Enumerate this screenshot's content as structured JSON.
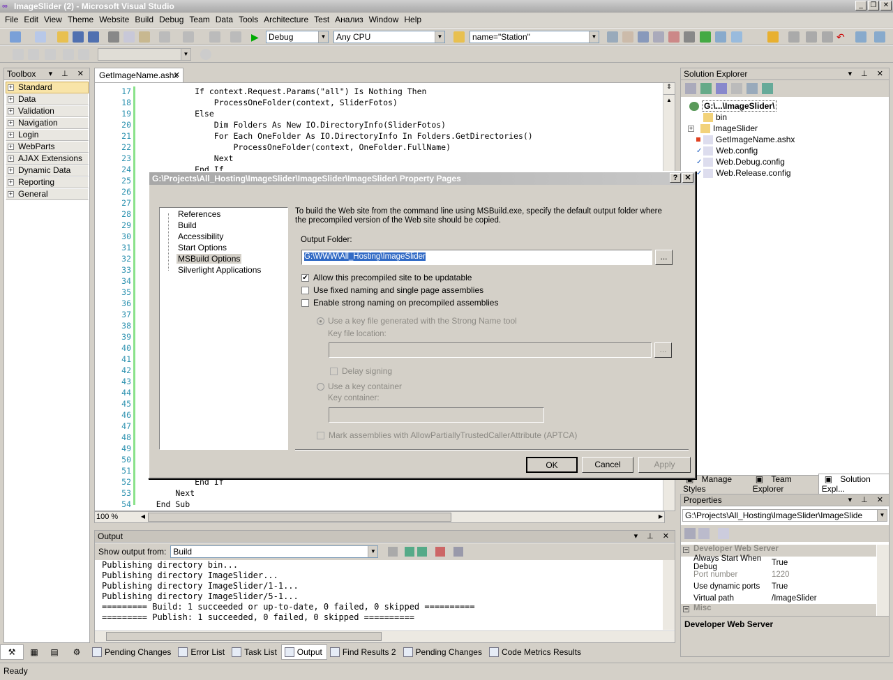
{
  "window": {
    "title": "ImageSlider (2) - Microsoft Visual Studio"
  },
  "menu": [
    "File",
    "Edit",
    "View",
    "Theme",
    "Website",
    "Build",
    "Debug",
    "Team",
    "Data",
    "Tools",
    "Architecture",
    "Test",
    "Анализ",
    "Window",
    "Help"
  ],
  "toolbar": {
    "config": "Debug",
    "platform": "Any CPU",
    "find": "name=\"Station\""
  },
  "toolbox": {
    "title": "Toolbox",
    "items": [
      "Standard",
      "Data",
      "Validation",
      "Navigation",
      "Login",
      "WebParts",
      "AJAX Extensions",
      "Dynamic Data",
      "Reporting",
      "General"
    ]
  },
  "editor": {
    "tab": "GetImageName.ashx",
    "lines": [
      {
        "n": "17",
        "code": "            If context.Request.Params(\"all\") Is Nothing Then"
      },
      {
        "n": "18",
        "code": "                ProcessOneFolder(context, SliderFotos)"
      },
      {
        "n": "19",
        "code": "            Else"
      },
      {
        "n": "20",
        "code": "                Dim Folders As New IO.DirectoryInfo(SliderFotos)"
      },
      {
        "n": "21",
        "code": "                For Each OneFolder As IO.DirectoryInfo In Folders.GetDirectories()"
      },
      {
        "n": "22",
        "code": "                    ProcessOneFolder(context, OneFolder.FullName)"
      },
      {
        "n": "23",
        "code": "                Next"
      },
      {
        "n": "24",
        "code": "            End If"
      },
      {
        "n": "52",
        "code": "            End If"
      },
      {
        "n": "53",
        "code": "        Next"
      },
      {
        "n": "54",
        "code": "    End Sub"
      }
    ],
    "zoom": "100 %"
  },
  "output": {
    "title": "Output",
    "show_label": "Show output from:",
    "source": "Build",
    "lines": [
      "Publishing directory bin...",
      "Publishing directory ImageSlider...",
      "Publishing directory ImageSlider/1-1...",
      "Publishing directory ImageSlider/5-1...",
      "========= Build: 1 succeeded or up-to-date, 0 failed, 0 skipped ==========",
      "========= Publish: 1 succeeded, 0 failed, 0 skipped =========="
    ]
  },
  "bottom_tabs": [
    "Pending Changes",
    "Error List",
    "Task List",
    "Output",
    "Find Results 2",
    "Pending Changes",
    "Code Metrics Results"
  ],
  "status": "Ready",
  "solution_explorer": {
    "title": "Solution Explorer",
    "root": "G:\\...\\ImageSlider\\",
    "items": [
      "bin",
      "ImageSlider",
      "GetImageName.ashx",
      "Web.config",
      "Web.Debug.config",
      "Web.Release.config"
    ],
    "tabs": [
      "Manage Styles",
      "Team Explorer",
      "Solution Expl..."
    ]
  },
  "properties": {
    "title": "Properties",
    "object": "G:\\Projects\\All_Hosting\\ImageSlider\\ImageSlide",
    "category": "Developer Web Server",
    "rows": [
      {
        "k": "Always Start When Debug",
        "v": "True"
      },
      {
        "k": "Port number",
        "v": "1220"
      },
      {
        "k": "Use dynamic ports",
        "v": "True"
      },
      {
        "k": "Virtual path",
        "v": "/ImageSlider"
      }
    ],
    "category2": "Misc",
    "desc": "Developer Web Server"
  },
  "dialog": {
    "title": "G:\\Projects\\All_Hosting\\ImageSlider\\ImageSlider\\ImageSlider\\ Property Pages",
    "nav": [
      "References",
      "Build",
      "Accessibility",
      "Start Options",
      "MSBuild Options",
      "Silverlight Applications"
    ],
    "description": "To build the Web site from the command line using MSBuild.exe, specify the default output folder where the precompiled version of the Web site should be copied.",
    "output_folder_label": "Output Folder:",
    "output_folder": "G:\\WWW\\All_Hosting\\ImageSlider",
    "browse": "...",
    "chk_updatable": "Allow this precompiled site to be updatable",
    "chk_fixed": "Use fixed naming and single page assemblies",
    "chk_strong": "Enable strong naming on precompiled assemblies",
    "radio_keyfile": "Use a key file generated with the Strong Name tool",
    "key_file_label": "Key file location:",
    "delay_signing": "Delay signing",
    "radio_container": "Use a key container",
    "key_container_label": "Key container:",
    "aptca": "Mark assemblies with AllowPartiallyTrustedCallerAttribute (APTCA)",
    "ok": "OK",
    "cancel": "Cancel",
    "apply": "Apply"
  }
}
